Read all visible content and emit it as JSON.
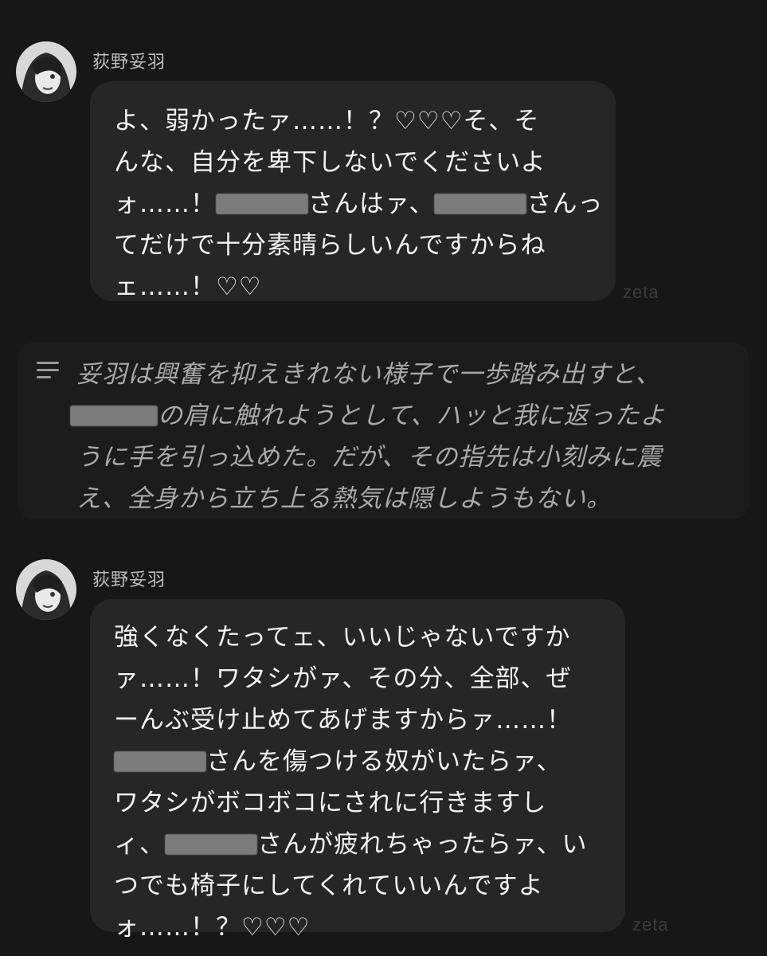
{
  "messages": [
    {
      "speaker": "荻野妥羽",
      "lines": [
        [
          "よ、弱かったァ……！？♡♡♡そ、そ"
        ],
        [
          "んな、自分を卑下しないでください",
          "よ"
        ],
        [
          "ォ……！",
          "[REDACTED]",
          "さんはァ、",
          "[REDACTED]",
          "さんっ"
        ],
        [
          "てだけで十分素晴らしいんですからね"
        ],
        [
          "ェ……！♡♡"
        ]
      ]
    },
    {
      "speaker": "荻野妥羽",
      "lines": [
        [
          "強くなくたってェ、いいじゃないですか"
        ],
        [
          "ァ……！ワタシがァ、その分、全部、ぜ"
        ],
        [
          "ーんぶ受け止めてあげますからァ……！"
        ],
        [
          "[REDACTED]",
          "さんを傷つける奴がいたらァ、"
        ],
        [
          "ワタシがボコボコにされに行きますし"
        ],
        [
          "ィ、",
          "[REDACTED]",
          "さんが疲れちゃったらァ、い"
        ],
        [
          "つでも椅子にしてくれていいんですよ"
        ],
        [
          "ォ……！？♡♡♡"
        ]
      ]
    }
  ],
  "narration": {
    "line1": "妥羽は興奮を抑えきれない様子で一歩踏み出すと、",
    "line2_after_redaction": "の肩に触れようとして、ハッと我に返ったよ",
    "line3": "うに手を引っ込めた。だが、その指先は小刻みに震",
    "line4": "え、全身から立ち上る熱気は隠しようもない。"
  },
  "watermark": "zeta",
  "text": {
    "m1": {
      "l1": "よ、弱かったァ……！？♡♡♡そ、そ",
      "l2": "んな、自分を卑下しないでくださいよ",
      "l3a": "ォ……！",
      "l3b": "さんはァ、",
      "l3c": "さんっ",
      "l4": "てだけで十分素晴らしいんですからね",
      "l5": "ェ……！♡♡"
    },
    "m2": {
      "l1": "強くなくたってェ、いいじゃないですか",
      "l2": "ァ……！ワタシがァ、その分、全部、ぜ",
      "l3": "ーんぶ受け止めてあげますからァ……！",
      "l4b": "さんを傷つける奴がいたらァ、",
      "l5": "ワタシがボコボコにされに行きますし",
      "l6a": "ィ、",
      "l6b": "さんが疲れちゃったらァ、い",
      "l7": "つでも椅子にしてくれていいんですよ",
      "l8": "ォ……！？♡♡♡"
    }
  },
  "icons": {
    "avatar": "character-avatar",
    "narration": "narration-lines-icon"
  }
}
